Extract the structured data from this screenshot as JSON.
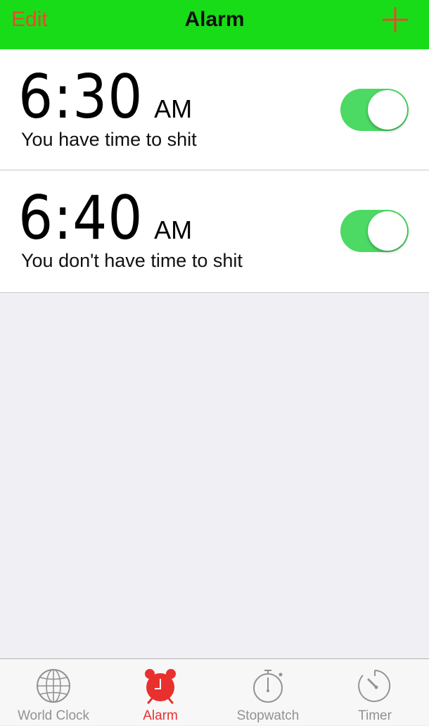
{
  "navbar": {
    "edit_label": "Edit",
    "title": "Alarm",
    "add_icon": "plus-icon",
    "background": "#19dc19",
    "accent": "#e84a2a"
  },
  "alarms": [
    {
      "time": "6:30",
      "ampm": "AM",
      "label": "You have time to shit",
      "enabled": true
    },
    {
      "time": "6:40",
      "ampm": "AM",
      "label": "You don't have time to shit",
      "enabled": true
    }
  ],
  "toggle_on_color": "#4cd964",
  "tabbar": {
    "tabs": [
      {
        "label": "World Clock",
        "icon": "globe-icon",
        "active": false
      },
      {
        "label": "Alarm",
        "icon": "alarm-clock-icon",
        "active": true
      },
      {
        "label": "Stopwatch",
        "icon": "stopwatch-icon",
        "active": false
      },
      {
        "label": "Timer",
        "icon": "timer-icon",
        "active": false
      }
    ],
    "active_color": "#e8312e",
    "inactive_color": "#929292"
  }
}
